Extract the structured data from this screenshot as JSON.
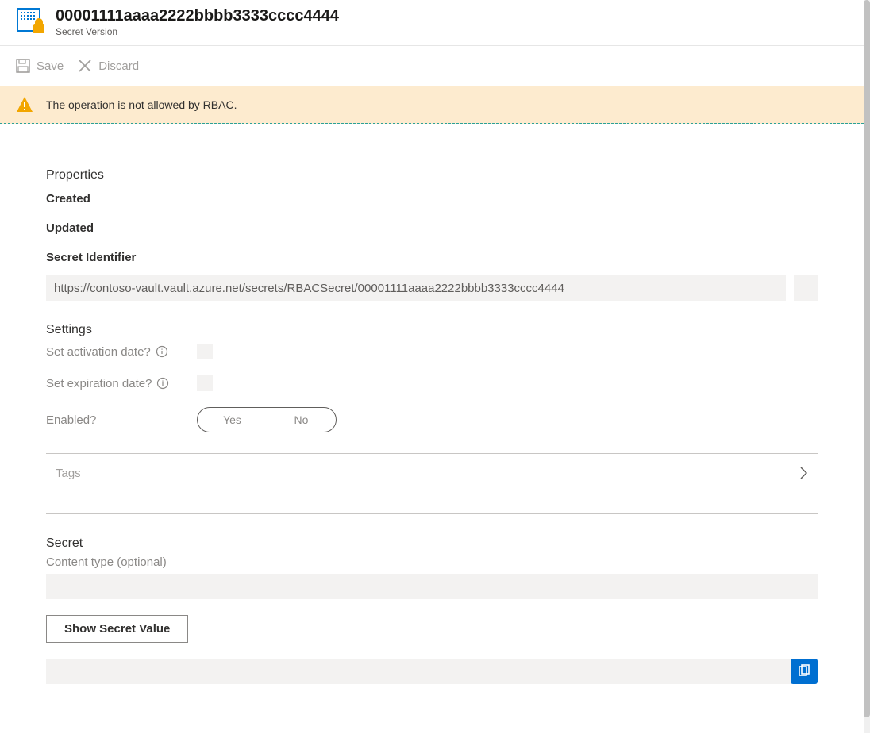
{
  "header": {
    "title": "00001111aaaa2222bbbb3333cccc4444",
    "subtitle": "Secret Version"
  },
  "commandBar": {
    "save": "Save",
    "discard": "Discard"
  },
  "banner": {
    "message": "The operation is not allowed by RBAC."
  },
  "properties": {
    "heading": "Properties",
    "createdLabel": "Created",
    "updatedLabel": "Updated",
    "identifierLabel": "Secret Identifier",
    "identifierValue": "https://contoso-vault.vault.azure.net/secrets/RBACSecret/00001111aaaa2222bbbb3333cccc4444"
  },
  "settings": {
    "heading": "Settings",
    "activationLabel": "Set activation date?",
    "expirationLabel": "Set expiration date?",
    "enabledLabel": "Enabled?",
    "toggle": {
      "yes": "Yes",
      "no": "No"
    }
  },
  "tags": {
    "label": "Tags"
  },
  "secret": {
    "heading": "Secret",
    "contentTypeLabel": "Content type (optional)",
    "showButton": "Show Secret Value"
  }
}
